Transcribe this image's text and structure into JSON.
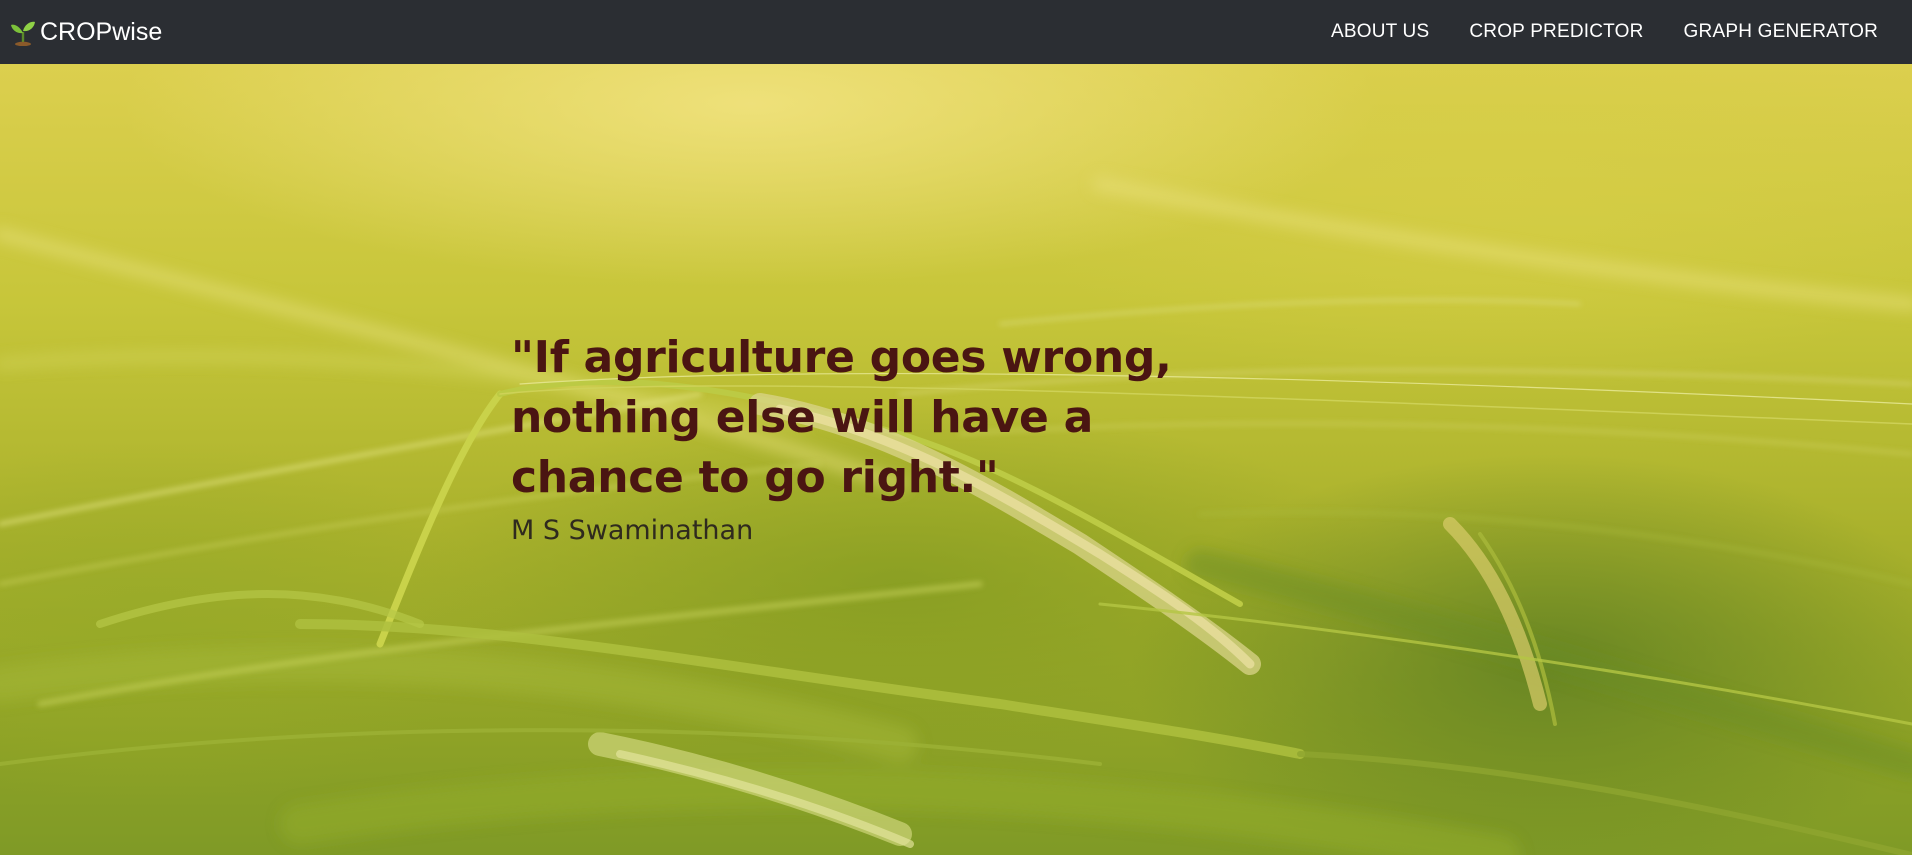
{
  "navbar": {
    "brand_icon": "sprout-icon",
    "brand_label": "CROPwise",
    "links": [
      {
        "label": "ABOUT US"
      },
      {
        "label": "CROP PREDICTOR"
      },
      {
        "label": "GRAPH GENERATOR"
      }
    ],
    "background_color": "#2b2e33"
  },
  "hero": {
    "background_image": "wheat-field-photo",
    "quote": "\"If agriculture goes wrong, nothing else will have a chance to go right.\"",
    "author": "M S Swaminathan",
    "quote_color": "#4a1512"
  }
}
